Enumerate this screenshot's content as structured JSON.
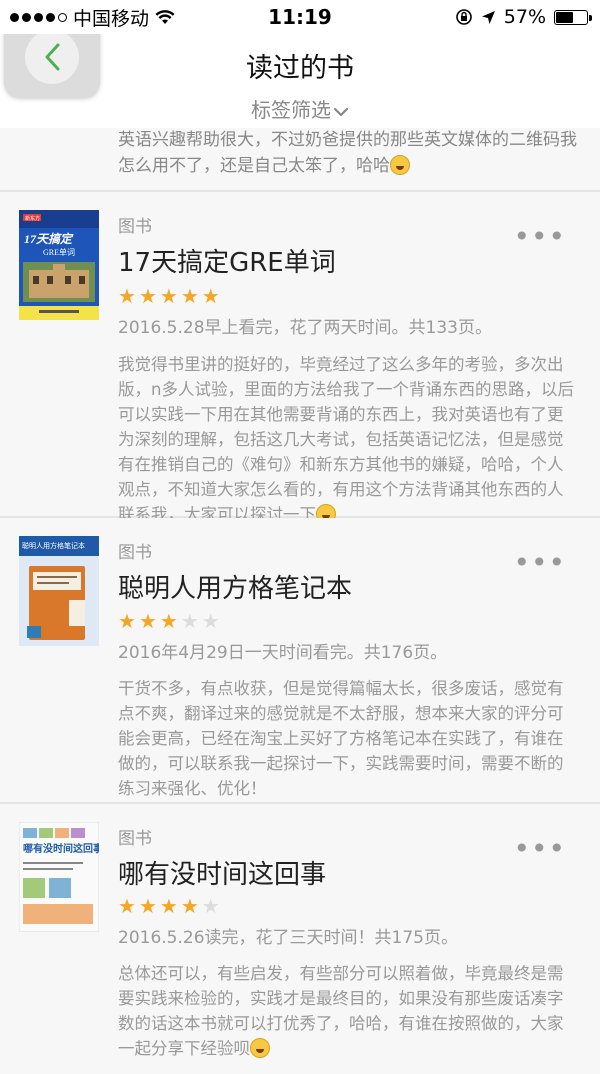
{
  "status_bar": {
    "carrier": "中国移动",
    "time": "11:19",
    "battery": "57%",
    "battery_level": 0.57
  },
  "header": {
    "title": "读过的书",
    "filter_label": "标签筛选"
  },
  "partial_review": "英语兴趣帮助很大，不过奶爸提供的那些英文媒体的二维码我怎么用不了，还是自己太笨了，哈哈",
  "books": [
    {
      "category": "图书",
      "title": "17天搞定GRE单词",
      "rating": 5,
      "meta": "2016.5.28早上看完，花了两天时间。共133页。",
      "review": "我觉得书里讲的挺好的，毕竟经过了这么多年的考验，多次出版，n多人试验，里面的方法给我了一个背诵东西的思路，以后可以实践一下用在其他需要背诵的东西上，我对英语也有了更为深刻的理解，包括这几大考试，包括英语记忆法，但是感觉有在推销自己的《难句》和新东方其他书的嫌疑，哈哈，个人观点，不知道大家怎么看的，有用这个方法背诵其他东西的人联系我，大家可以探讨一下",
      "emoji": true,
      "cover": {
        "top_text": "17天搞定",
        "sub_text": "GRE单词",
        "logo": "新东方"
      }
    },
    {
      "category": "图书",
      "title": "聪明人用方格笔记本",
      "rating": 3,
      "meta": "2016年4月29日一天时间看完。共176页。",
      "review": "干货不多，有点收获，但是觉得篇幅太长，很多废话，感觉有点不爽，翻译过来的感觉就是不太舒服，想本来大家的评分可能会更高，已经在淘宝上买好了方格笔记本在实践了，有谁在做的，可以联系我一起探讨一下，实践需要时间，需要不断的练习来强化、优化！",
      "emoji": false,
      "cover": {
        "top_text": "聪明人用方格笔记本"
      }
    },
    {
      "category": "图书",
      "title": "哪有没时间这回事",
      "rating": 4,
      "meta": "2016.5.26读完，花了三天时间！共175页。",
      "review": "总体还可以，有些启发，有些部分可以照着做，毕竟最终是需要实践来检验的，实践才是最终目的，如果没有那些废话凑字数的话这本书就可以打优秀了，哈哈，有谁在按照做的，大家一起分享下经验呗",
      "emoji": true,
      "cover": {
        "top_text": "哪有没时间这回事"
      }
    }
  ],
  "icons": {
    "back": "chevron-left-icon",
    "filter": "chevron-down-icon",
    "more": "more-dots-icon",
    "star": "star-icon"
  },
  "colors": {
    "accent_green": "#4caf50",
    "star": "#f5a623"
  }
}
